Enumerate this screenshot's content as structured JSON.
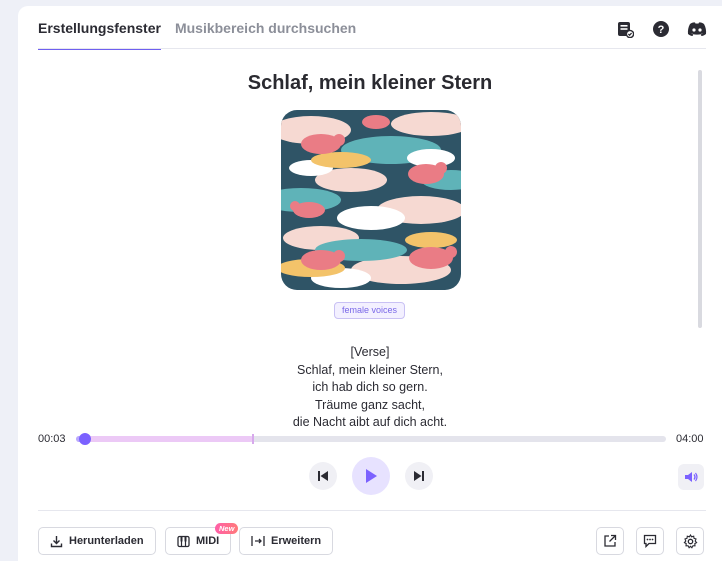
{
  "tabs": {
    "create": "Erstellungsfenster",
    "browse": "Musikbereich durchsuchen"
  },
  "header_icons": [
    "playlist-check-icon",
    "help-icon",
    "discord-icon"
  ],
  "song": {
    "title": "Schlaf, mein kleiner Stern",
    "tag": "female voices",
    "lyrics": [
      "[Verse]",
      "Schlaf, mein kleiner Stern,",
      "ich hab dich so gern.",
      "Träume ganz sacht,",
      "die Nacht aibt auf dich acht."
    ]
  },
  "player": {
    "current_time": "00:03",
    "total_time": "04:00",
    "progress_fraction": 0.0125,
    "buffered_fraction": 0.3
  },
  "actions": {
    "download": "Herunterladen",
    "midi": "MIDI",
    "midi_badge": "New",
    "extend": "Erweitern"
  },
  "colors": {
    "accent": "#6f5ff0",
    "thumb": "#7b61ff"
  }
}
